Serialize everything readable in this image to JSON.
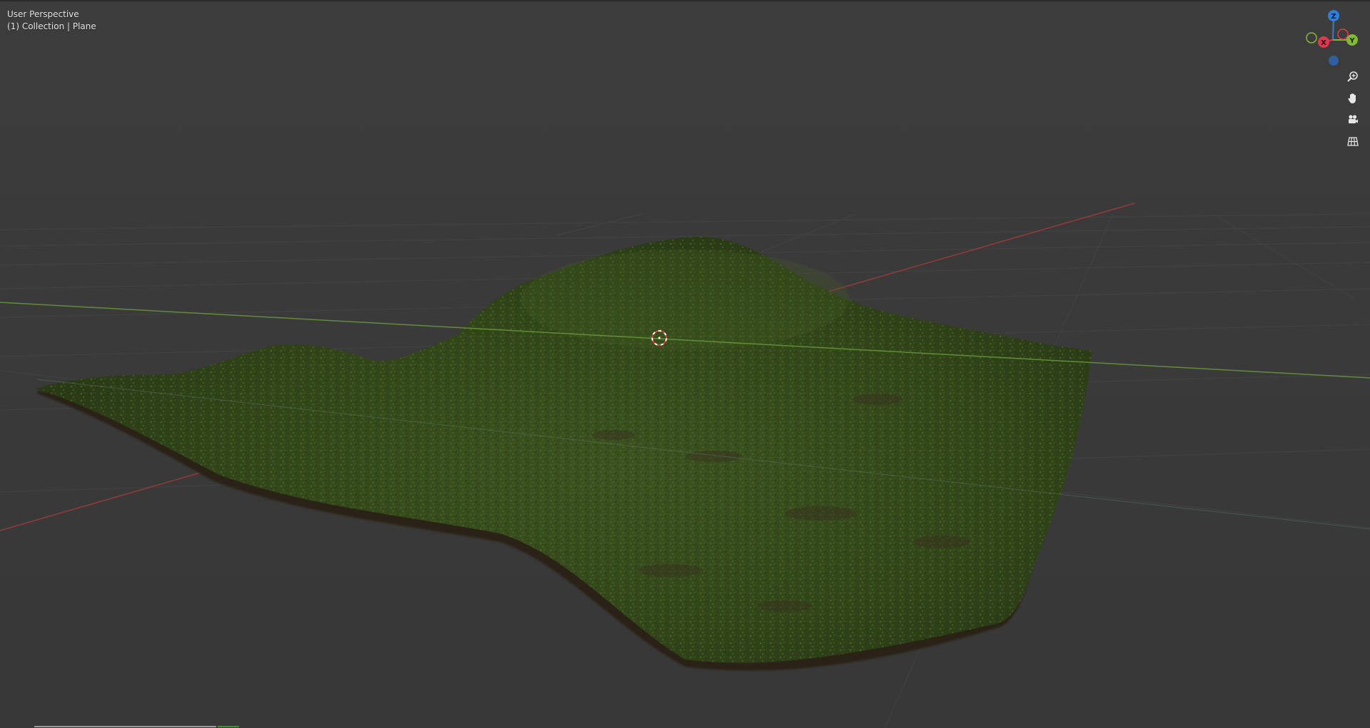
{
  "viewport": {
    "view_name": "User Perspective",
    "collection_path": "(1) Collection | Plane"
  },
  "gizmo": {
    "axis_z_label": "Z",
    "axis_x_label": "X",
    "axis_y_label": "Y",
    "colors": {
      "x": "#e0394f",
      "y": "#84b83a",
      "z": "#2f7fd6"
    }
  },
  "navigation": {
    "zoom_icon": "zoom-icon",
    "pan_icon": "hand-icon",
    "camera_icon": "camera-icon",
    "ortho_icon": "grid-icon"
  },
  "scene": {
    "object": "grass terrain",
    "grass_color": "#3f5a22",
    "soil_color": "#3a2e22"
  }
}
